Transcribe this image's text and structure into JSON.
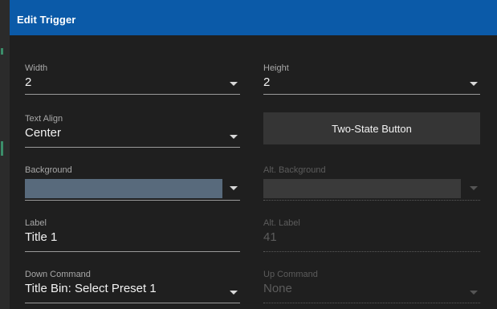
{
  "dialog": {
    "title": "Edit Trigger"
  },
  "fields": {
    "width": {
      "label": "Width",
      "value": "2"
    },
    "height": {
      "label": "Height",
      "value": "2"
    },
    "text_align": {
      "label": "Text Align",
      "value": "Center"
    },
    "two_state_button": {
      "label": "Two-State Button"
    },
    "background": {
      "label": "Background",
      "color": "#586a7c"
    },
    "alt_background": {
      "label": "Alt. Background",
      "color": "#3a3a3a"
    },
    "label": {
      "label": "Label",
      "value": "Title 1"
    },
    "alt_label": {
      "label": "Alt. Label",
      "value": "41"
    },
    "down_command": {
      "label": "Down Command",
      "value": "Title Bin: Select Preset 1"
    },
    "up_command": {
      "label": "Up Command",
      "value": "None"
    }
  },
  "colors": {
    "title_bar": "#0b5aa8",
    "dialog_background": "#1f1f1f",
    "button_background": "#353535"
  }
}
